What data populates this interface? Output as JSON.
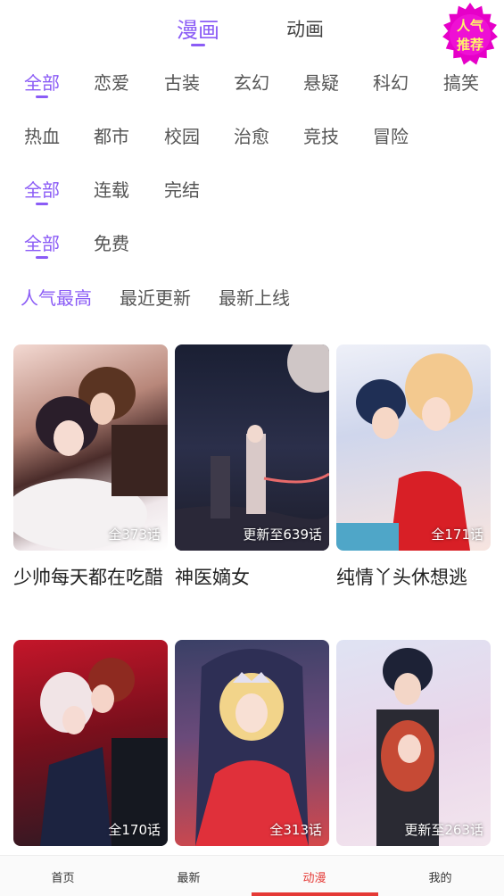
{
  "top_tabs": [
    {
      "label": "漫画",
      "active": true
    },
    {
      "label": "动画",
      "active": false
    }
  ],
  "badge": {
    "line1": "人气",
    "line2": "推荐",
    "color": "#e600c8",
    "text_color": "#fff36b"
  },
  "accent_color": "#8b5cf6",
  "genres_row1": [
    "全部",
    "恋爱",
    "古装",
    "玄幻",
    "悬疑",
    "科幻",
    "搞笑"
  ],
  "genres_row2": [
    "热血",
    "都市",
    "校园",
    "治愈",
    "竞技",
    "冒险"
  ],
  "status_filters": [
    "全部",
    "连载",
    "完结"
  ],
  "price_filters": [
    "全部",
    "免费"
  ],
  "sort_options": [
    "人气最高",
    "最近更新",
    "最新上线"
  ],
  "comics": [
    {
      "title": "少帅每天都在吃醋",
      "episodes": "全373话",
      "cover_icon": "couple-illustration"
    },
    {
      "title": "神医嫡女",
      "episodes": "更新至639话",
      "cover_icon": "night-scene-illustration"
    },
    {
      "title": "纯情丫头休想逃",
      "episodes": "全171话",
      "cover_icon": "couple-illustration"
    },
    {
      "title": "",
      "episodes": "全170话",
      "cover_icon": "dance-illustration"
    },
    {
      "title": "",
      "episodes": "全313话",
      "cover_icon": "princess-illustration"
    },
    {
      "title": "",
      "episodes": "更新至263话",
      "cover_icon": "couple-illustration"
    }
  ],
  "bottom_nav": [
    {
      "label": "首页",
      "active": false
    },
    {
      "label": "最新",
      "active": false
    },
    {
      "label": "动漫",
      "active": true
    },
    {
      "label": "我的",
      "active": false
    }
  ],
  "nav_active_color": "#e53935"
}
